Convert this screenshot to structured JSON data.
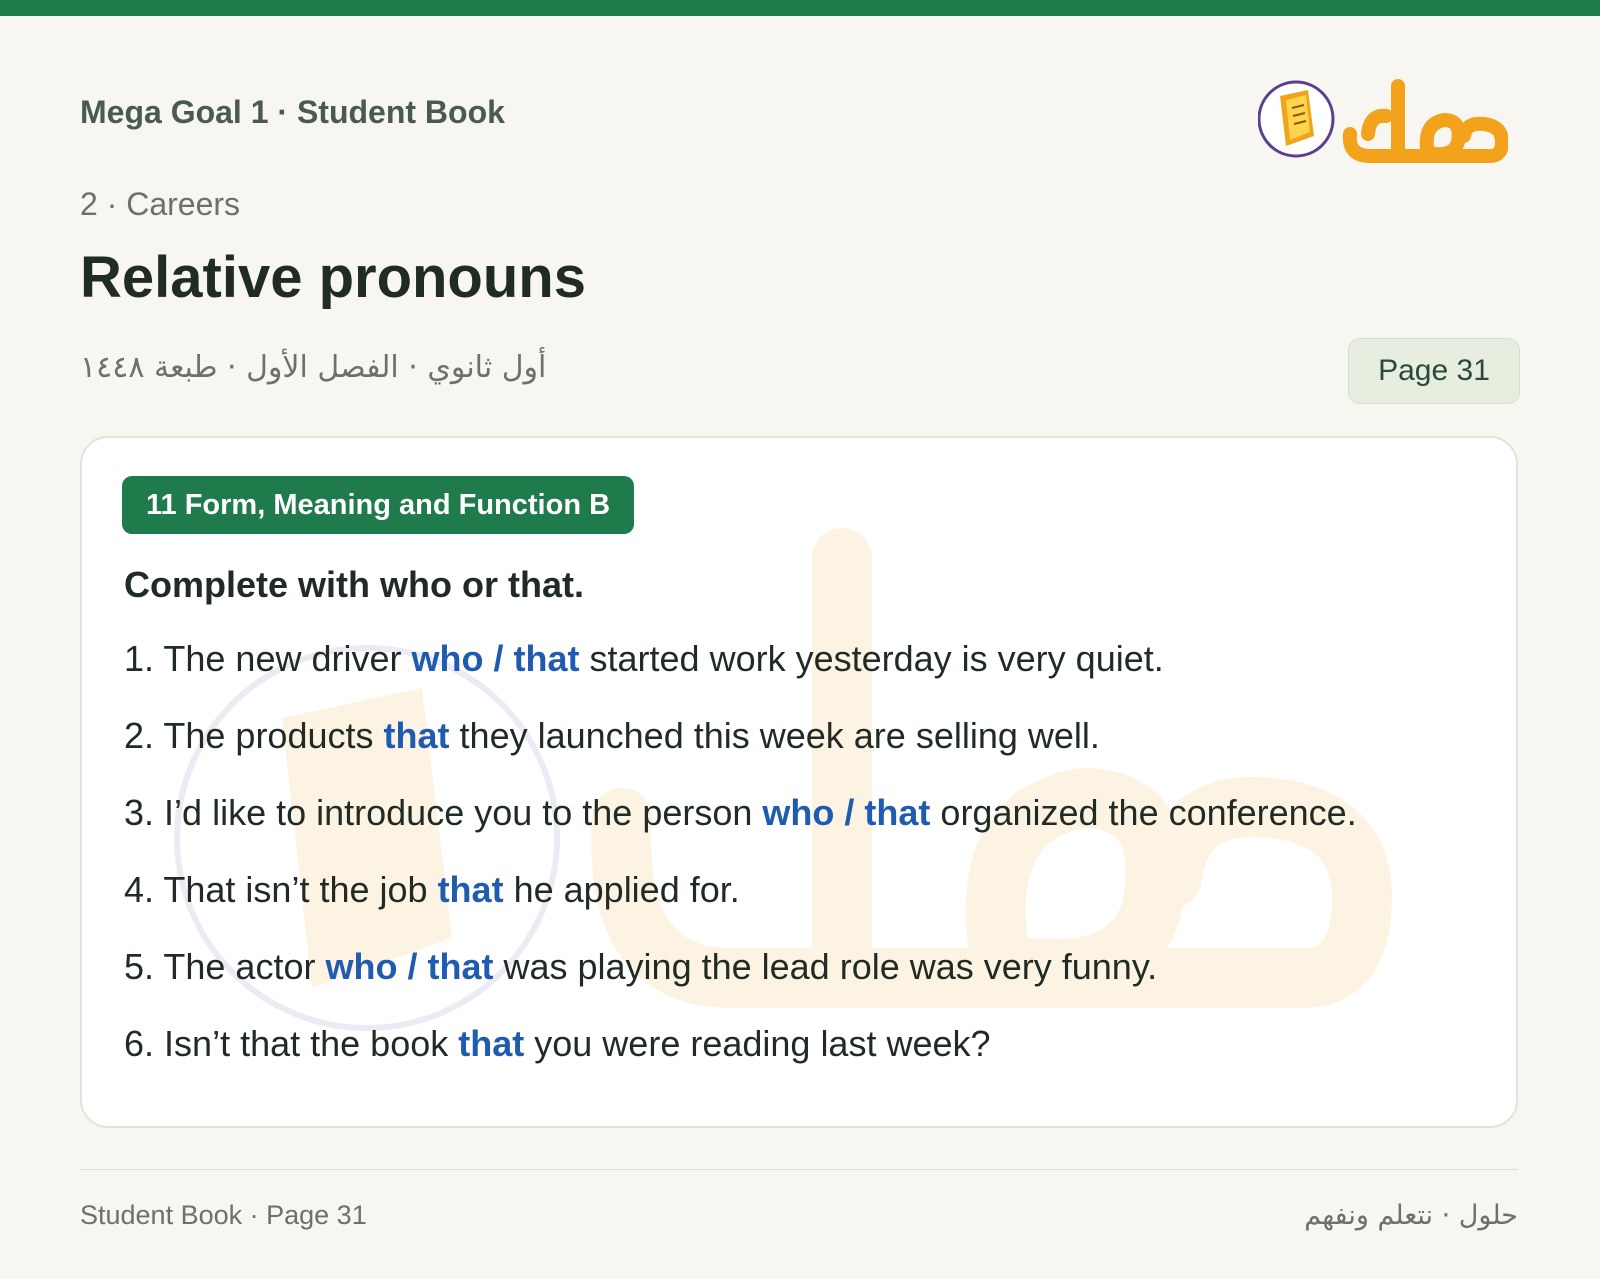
{
  "header": {
    "book_title": "Mega Goal 1 · Student Book",
    "logo_text": "حلول",
    "unit": "2 · Careers",
    "lesson_title": "Relative pronouns",
    "arabic_meta": "أول ثانوي · الفصل الأول · طبعة ١٤٤٨",
    "page_label": "Page 31"
  },
  "exercise": {
    "tag": "11 Form, Meaning and Function B",
    "instruction": "Complete with who or that.",
    "items": [
      {
        "number": "1.",
        "before": "The new driver",
        "answer": "who / that",
        "after": "started work yesterday is very quiet."
      },
      {
        "number": "2.",
        "before": "The products",
        "answer": "that",
        "after": "they launched this week are selling well."
      },
      {
        "number": "3.",
        "before": "I’d like to introduce you to the person",
        "answer": "who / that",
        "after": "organized the conference."
      },
      {
        "number": "4.",
        "before": "That isn’t the job",
        "answer": "that",
        "after": "he applied for."
      },
      {
        "number": "5.",
        "before": "The actor",
        "answer": "who / that",
        "after": "was playing the lead role was very funny."
      },
      {
        "number": "6.",
        "before": "Isn’t that the book",
        "answer": "that",
        "after": "you were reading last week?"
      }
    ]
  },
  "footer": {
    "left": "Student Book · Page 31",
    "right": "حلول · نتعلم ونفهم"
  },
  "colors": {
    "brand_green": "#1f7a4c",
    "answer_blue": "#1f5bb0",
    "logo_orange": "#f2a31b"
  }
}
